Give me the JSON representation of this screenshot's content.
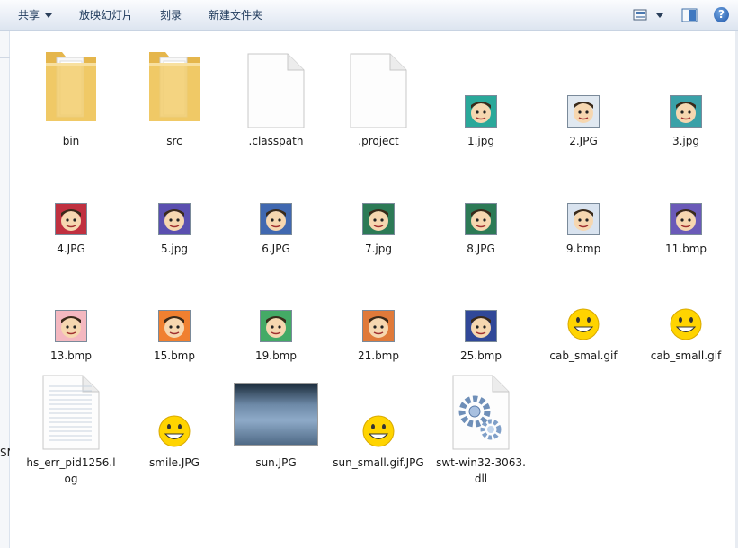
{
  "toolbar": {
    "share_label": "共享",
    "slideshow_label": "放映幻灯片",
    "burn_label": "刻录",
    "new_folder_label": "新建文件夹",
    "view_icon": "view-options-icon",
    "preview_pane_icon": "preview-pane-icon",
    "help_icon": "help-icon",
    "help_glyph": "?"
  },
  "left_pane": {
    "fragment": "SN"
  },
  "colors": {
    "folder": "#f2cd6b",
    "face_bg": "#2aa89a",
    "smile": "#ffd400"
  },
  "files": [
    {
      "name": "bin",
      "kind": "folder"
    },
    {
      "name": "src",
      "kind": "folder"
    },
    {
      "name": ".classpath",
      "kind": "document"
    },
    {
      "name": ".project",
      "kind": "document"
    },
    {
      "name": "1.jpg",
      "kind": "avatar"
    },
    {
      "name": "2.JPG",
      "kind": "avatar"
    },
    {
      "name": "3.jpg",
      "kind": "avatar"
    },
    {
      "name": "4.JPG",
      "kind": "avatar"
    },
    {
      "name": "5.jpg",
      "kind": "avatar"
    },
    {
      "name": "6.JPG",
      "kind": "avatar"
    },
    {
      "name": "7.jpg",
      "kind": "avatar"
    },
    {
      "name": "8.JPG",
      "kind": "avatar"
    },
    {
      "name": "9.bmp",
      "kind": "avatar"
    },
    {
      "name": "11.bmp",
      "kind": "avatar"
    },
    {
      "name": "13.bmp",
      "kind": "avatar"
    },
    {
      "name": "15.bmp",
      "kind": "avatar"
    },
    {
      "name": "19.bmp",
      "kind": "avatar"
    },
    {
      "name": "21.bmp",
      "kind": "avatar"
    },
    {
      "name": "25.bmp",
      "kind": "avatar"
    },
    {
      "name": "cab_smal.gif",
      "kind": "emoticon"
    },
    {
      "name": "cab_small.gif",
      "kind": "emoticon"
    },
    {
      "name": "hs_err_pid1256.log",
      "kind": "log"
    },
    {
      "name": "smile.JPG",
      "kind": "emoticon"
    },
    {
      "name": "sun.JPG",
      "kind": "photo"
    },
    {
      "name": "sun_small.gif.JPG",
      "kind": "emoticon"
    },
    {
      "name": "swt-win32-3063.dll",
      "kind": "dll"
    }
  ]
}
